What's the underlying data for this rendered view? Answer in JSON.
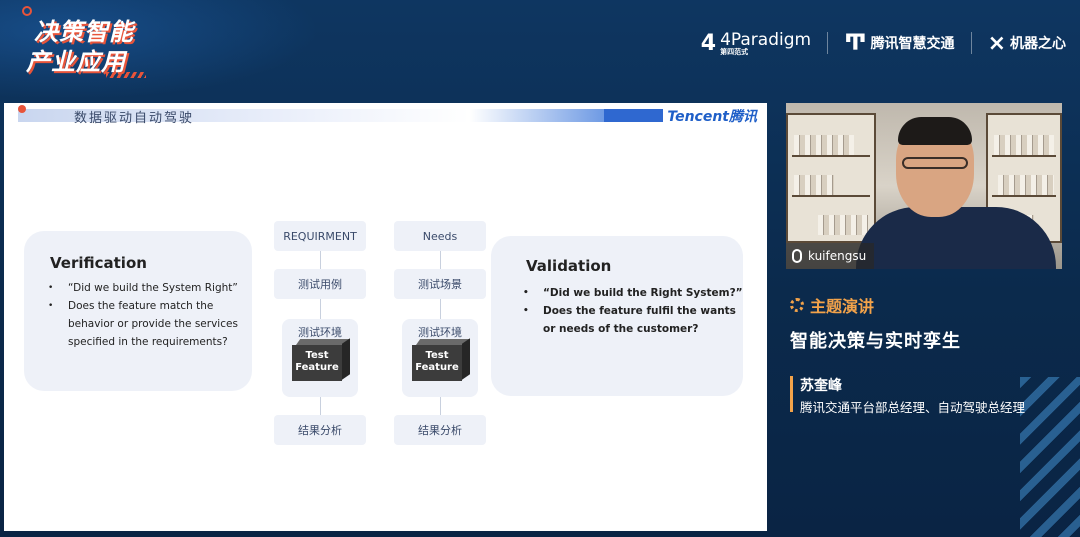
{
  "event": {
    "line1": "决策智能",
    "line2": "产业应用"
  },
  "sponsors": [
    {
      "name": "4Paradigm",
      "sub": "第四范式"
    },
    {
      "name": "腾讯智慧交通"
    },
    {
      "name": "机器之心"
    }
  ],
  "slide": {
    "title": "数据驱动自动驾驶",
    "brand": "Tencent腾讯",
    "verification": {
      "title": "Verification",
      "items": [
        "“Did we build the System Right”",
        "Does the feature match the behavior or provide the  services specified in the requirements?"
      ]
    },
    "validation": {
      "title": "Validation",
      "items": [
        "“Did we build the Right System?”",
        "Does the feature fulfil the wants or needs of the customer?"
      ]
    },
    "col_a": {
      "head": "REQUIRMENT",
      "step1": "测试用例",
      "step2": "测试环境",
      "box1": "Test",
      "box2": "Feature",
      "step3": "结果分析"
    },
    "col_b": {
      "head": "Needs",
      "step1": "测试场景",
      "step2": "测试环境",
      "box1": "Test",
      "box2": "Feature",
      "step3": "结果分析"
    }
  },
  "video": {
    "username": "kuifengsu"
  },
  "talk": {
    "label": "主题演讲",
    "title": "智能决策与实时孪生",
    "speaker": "苏奎峰",
    "role": "腾讯交通平台部总经理、自动驾驶总经理"
  },
  "colors": {
    "background": "#0d2e52",
    "accent": "#f3a34a",
    "tencent_blue": "#1f5fc8"
  }
}
